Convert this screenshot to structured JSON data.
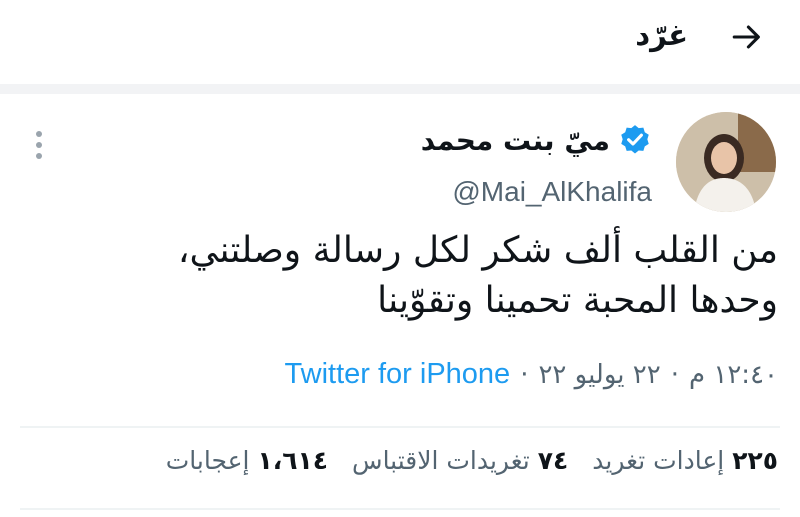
{
  "header": {
    "title": "غرّد",
    "back_icon": "arrow-right-icon"
  },
  "tweet": {
    "display_name": "ميّ بنت محمد",
    "handle": "@Mai_AlKhalifa",
    "verified_icon": "verified-badge-icon",
    "more_icon": "more-vertical-icon",
    "text_line1": "من القلب ألف شكر لكل رسالة وصلتني،",
    "text_line2": "وحدها المحبة تحمينا وتقوّينا",
    "time": "١٢:٤٠ م",
    "dot": "·",
    "date": "٢٢ يوليو ٢٢",
    "source": "Twitter for iPhone"
  },
  "stats": {
    "retweets_count": "٢٢٥",
    "retweets_label": "إعادات تغريد",
    "quotes_count": "٧٤",
    "quotes_label": "تغريدات الاقتباس",
    "likes_count": "١،٦١٤",
    "likes_label": "إعجابات"
  },
  "colors": {
    "accent": "#1d9bf0",
    "secondary_text": "#536471",
    "primary_text": "#0f1419"
  }
}
